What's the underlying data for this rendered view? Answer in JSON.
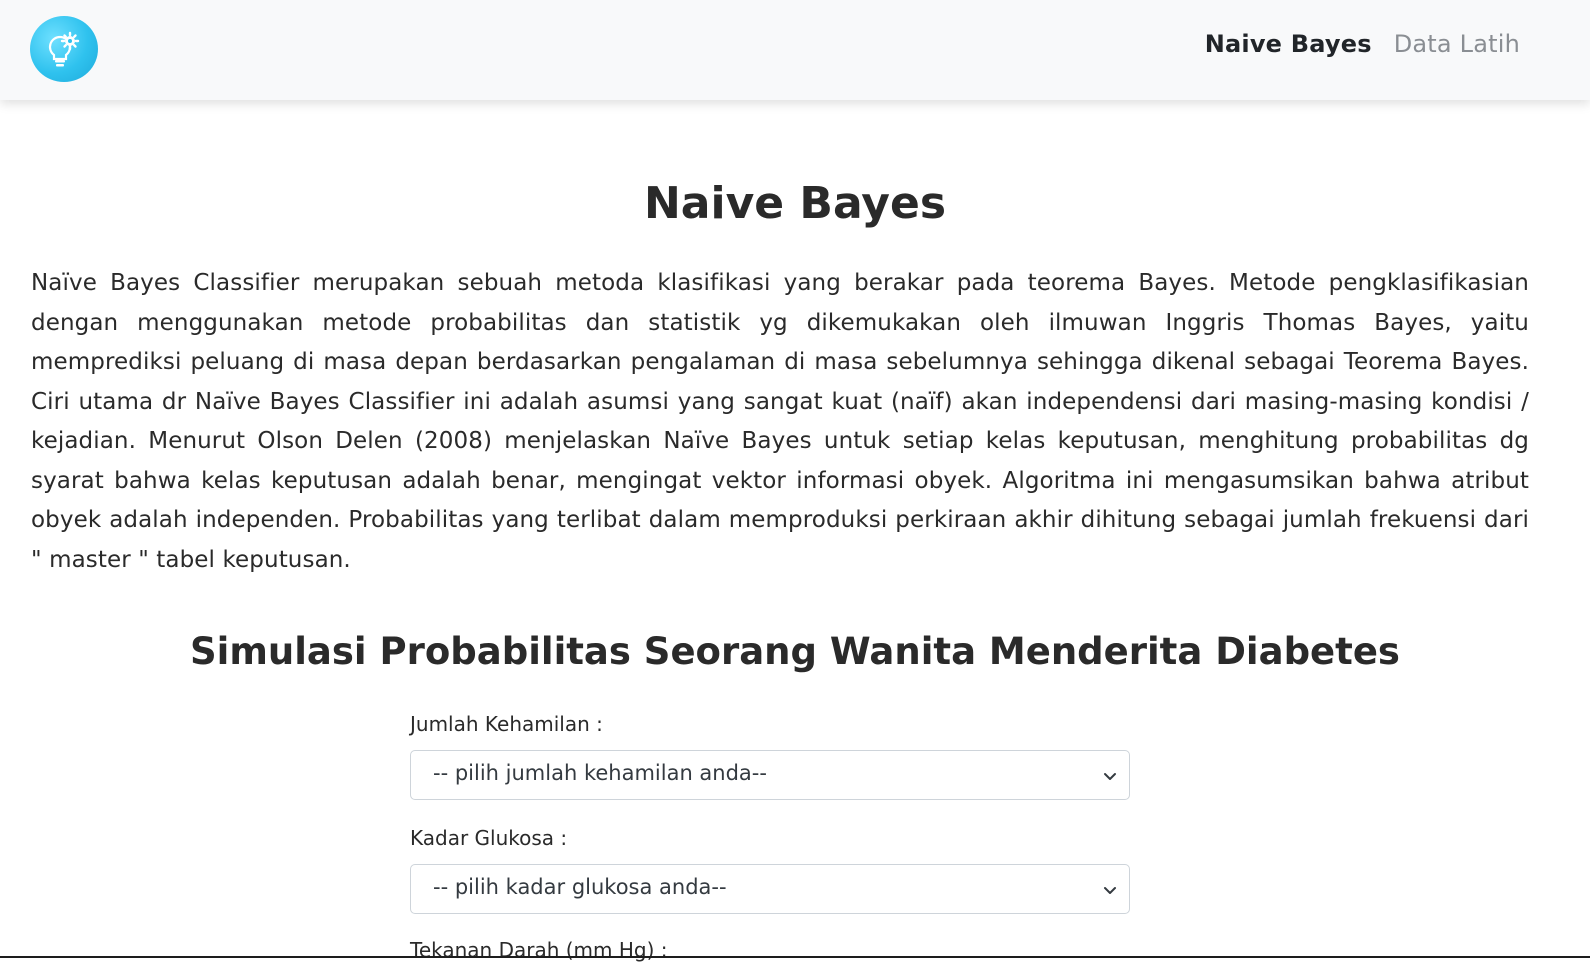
{
  "nav": {
    "logo_icon": "lightbulb-gear-icon",
    "items": [
      {
        "label": "Naive Bayes",
        "active": true
      },
      {
        "label": "Data Latih",
        "active": false
      }
    ]
  },
  "main": {
    "title": "Naive Bayes",
    "intro": "Naïve Bayes Classifier merupakan sebuah metoda klasifikasi yang berakar pada teorema Bayes. Metode pengklasifikasian dengan menggunakan metode probabilitas dan statistik yg dikemukakan oleh ilmuwan Inggris Thomas Bayes, yaitu memprediksi peluang di masa depan berdasarkan pengalaman di masa sebelumnya sehingga dikenal sebagai Teorema Bayes. Ciri utama dr Naïve Bayes Classifier ini adalah asumsi yang sangat kuat (naïf) akan independensi dari masing-masing kondisi / kejadian. Menurut Olson Delen (2008) menjelaskan Naïve Bayes untuk setiap kelas keputusan, menghitung probabilitas dg syarat bahwa kelas keputusan adalah benar, mengingat vektor informasi obyek. Algoritma ini mengasumsikan bahwa atribut obyek adalah independen. Probabilitas yang terlibat dalam memproduksi perkiraan akhir dihitung sebagai jumlah frekuensi dari \" master \" tabel keputusan.",
    "simulation_title": "Simulasi Probabilitas Seorang Wanita Menderita Diabetes"
  },
  "form": {
    "fields": [
      {
        "label": "Jumlah Kehamilan :",
        "selected": "-- pilih jumlah kehamilan anda--"
      },
      {
        "label": "Kadar Glukosa :",
        "selected": "-- pilih kadar glukosa anda--"
      },
      {
        "label": "Tekanan Darah (mm Hg) :"
      }
    ]
  },
  "colors": {
    "navbar_bg": "#f8f9fa",
    "logo_accent": "#2fc2ee",
    "text": "#212529",
    "muted_link": "#8a8e93"
  }
}
